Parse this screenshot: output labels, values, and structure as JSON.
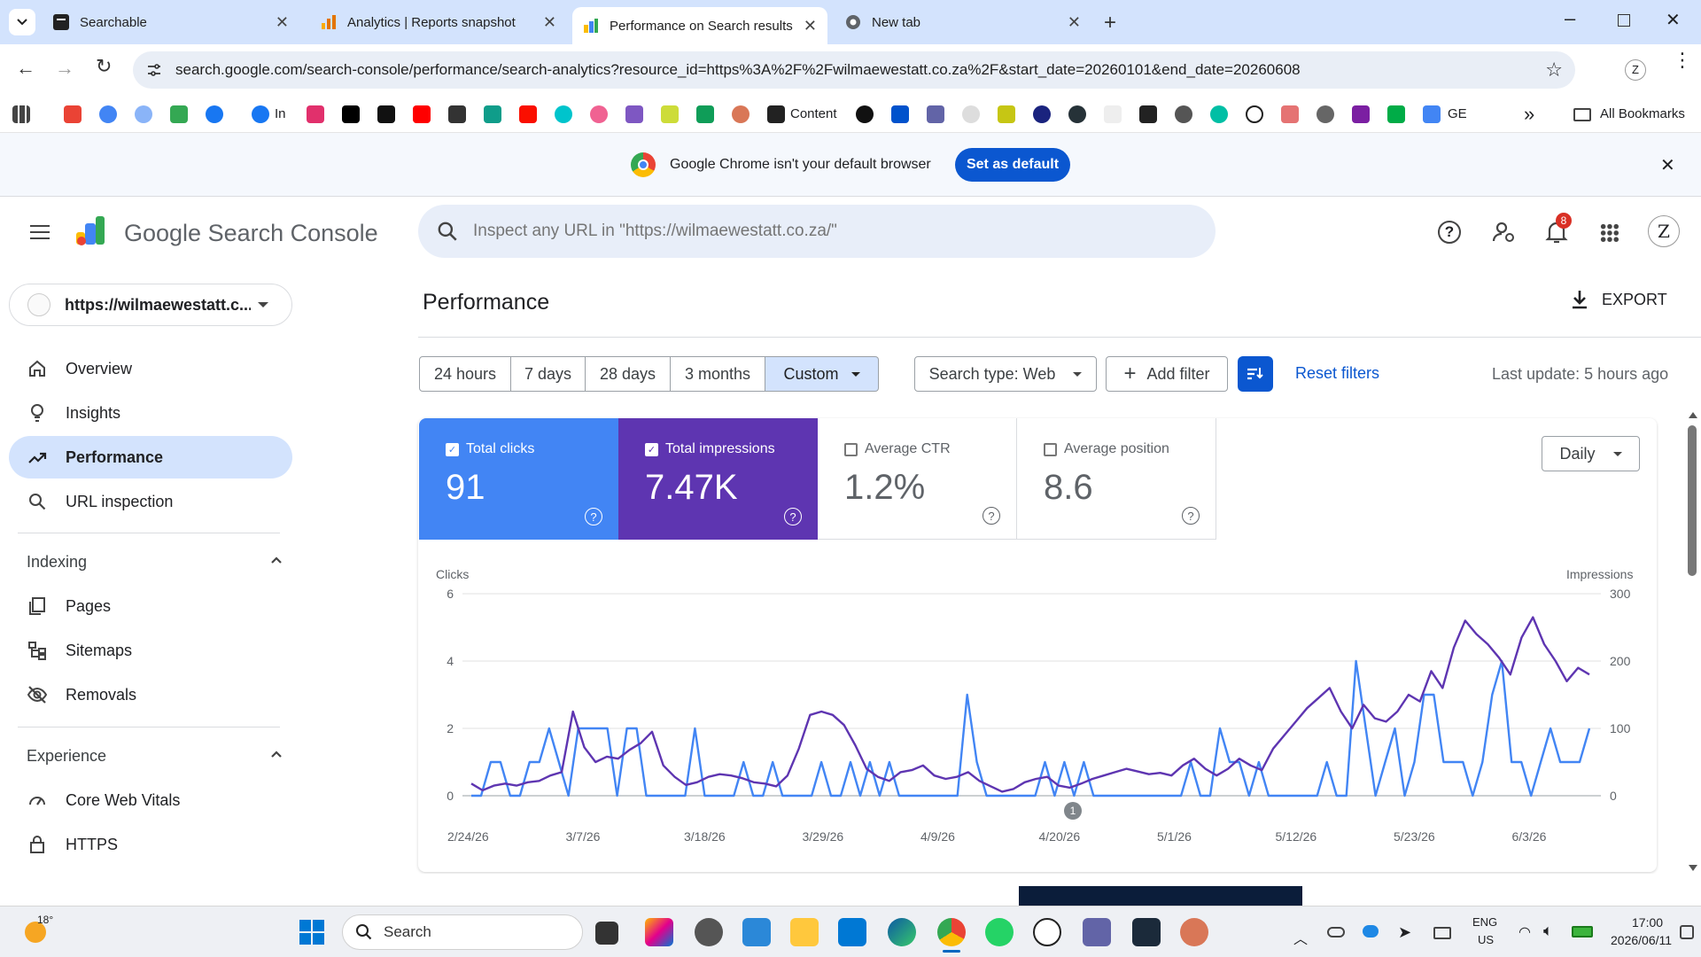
{
  "browser": {
    "tabs": [
      {
        "title": "Searchable",
        "icon": "searchable-icon"
      },
      {
        "title": "Analytics | Reports snapshot",
        "icon": "analytics-icon"
      },
      {
        "title": "Performance on Search results",
        "icon": "search-console-icon",
        "active": true
      },
      {
        "title": "New tab",
        "icon": "chrome-icon"
      }
    ],
    "url": "search.google.com/search-console/performance/search-analytics?resource_id=https%3A%2F%2Fwilmaewestatt.co.za%2F&start_date=20260101&end_date=20260608",
    "bookmarks": {
      "in_label": "In",
      "content_label": "Content",
      "ge_label": "GE",
      "all_bookmarks": "All Bookmarks"
    },
    "infobar": {
      "message": "Google Chrome isn't your default browser",
      "button": "Set as default"
    }
  },
  "gsc": {
    "logo_text": "Google Search Console",
    "search_placeholder": "Inspect any URL in \"https://wilmaewestatt.co.za/\"",
    "notification_count": "8",
    "property": "https://wilmaewestatt.c...",
    "nav": {
      "overview": "Overview",
      "insights": "Insights",
      "performance": "Performance",
      "url_inspection": "URL inspection",
      "indexing_header": "Indexing",
      "pages": "Pages",
      "sitemaps": "Sitemaps",
      "removals": "Removals",
      "experience_header": "Experience",
      "core_web_vitals": "Core Web Vitals",
      "https": "HTTPS"
    },
    "page_title": "Performance",
    "export": "EXPORT",
    "date_ranges": [
      "24 hours",
      "7 days",
      "28 days",
      "3 months",
      "Custom"
    ],
    "search_type": "Search type: Web",
    "add_filter": "Add filter",
    "reset_filters": "Reset filters",
    "last_update": "Last update: 5 hours ago",
    "metrics": {
      "clicks": {
        "label": "Total clicks",
        "value": "91"
      },
      "impressions": {
        "label": "Total impressions",
        "value": "7.47K"
      },
      "ctr": {
        "label": "Average CTR",
        "value": "1.2%"
      },
      "position": {
        "label": "Average position",
        "value": "8.6"
      }
    },
    "granularity": "Daily",
    "annotation_marker": "1",
    "colors": {
      "clicks": "#4285f4",
      "impressions": "#5e35b1",
      "accent": "#0b57d0"
    }
  },
  "chart_data": {
    "type": "line",
    "ylabel_left": "Clicks",
    "ylabel_right": "Impressions",
    "yticks_left": [
      "6",
      "4",
      "2",
      "0"
    ],
    "yticks_right": [
      "300",
      "200",
      "100",
      "0"
    ],
    "ylim_left": [
      0,
      6
    ],
    "ylim_right": [
      0,
      300
    ],
    "xtick_labels": [
      "2/24/26",
      "3/7/26",
      "3/18/26",
      "3/29/26",
      "4/9/26",
      "4/20/26",
      "5/1/26",
      "5/12/26",
      "5/23/26",
      "6/3/26"
    ],
    "grid": true,
    "series": [
      {
        "name": "Clicks",
        "axis": "left",
        "color": "#4285f4",
        "values": [
          0,
          0,
          1,
          1,
          0,
          0,
          1,
          1,
          2,
          1,
          0,
          2,
          2,
          2,
          2,
          0,
          2,
          2,
          0,
          0,
          0,
          0,
          0,
          2,
          0,
          0,
          0,
          0,
          1,
          0,
          0,
          1,
          0,
          0,
          0,
          0,
          1,
          0,
          0,
          1,
          0,
          1,
          0,
          1,
          0,
          0,
          0,
          0,
          0,
          0,
          0,
          3,
          1,
          0,
          0,
          0,
          0,
          0,
          0,
          1,
          0,
          1,
          0,
          1,
          0,
          0,
          0,
          0,
          0,
          0,
          0,
          0,
          0,
          0,
          1,
          0,
          0,
          2,
          1,
          1,
          0,
          1,
          0,
          0,
          0,
          0,
          0,
          0,
          1,
          0,
          0,
          4,
          2,
          0,
          1,
          2,
          0,
          1,
          3,
          3,
          1,
          1,
          1,
          0,
          1,
          3,
          4,
          1,
          1,
          0,
          1,
          2,
          1,
          1,
          1,
          2
        ],
        "offset_start_day": 0
      },
      {
        "name": "Impressions",
        "axis": "right",
        "color": "#5e35b1",
        "values": [
          18,
          8,
          15,
          18,
          15,
          20,
          22,
          30,
          35,
          125,
          72,
          50,
          58,
          55,
          68,
          78,
          95,
          45,
          28,
          16,
          20,
          28,
          32,
          30,
          26,
          20,
          18,
          14,
          30,
          70,
          120,
          125,
          120,
          105,
          75,
          40,
          28,
          22,
          35,
          38,
          45,
          30,
          25,
          28,
          35,
          22,
          14,
          6,
          10,
          20,
          25,
          28,
          15,
          12,
          18,
          25,
          30,
          35,
          40,
          36,
          32,
          34,
          30,
          45,
          55,
          40,
          30,
          40,
          55,
          45,
          38,
          70,
          90,
          110,
          130,
          145,
          160,
          125,
          100,
          135,
          115,
          110,
          125,
          150,
          140,
          185,
          160,
          220,
          260,
          240,
          225,
          205,
          180,
          235,
          265,
          225,
          200,
          170,
          190,
          180
        ]
      }
    ]
  },
  "taskbar": {
    "weather": "18°",
    "search": "Search",
    "lang": "ENG",
    "region": "US",
    "time": "17:00",
    "date": "2026/06/11"
  }
}
